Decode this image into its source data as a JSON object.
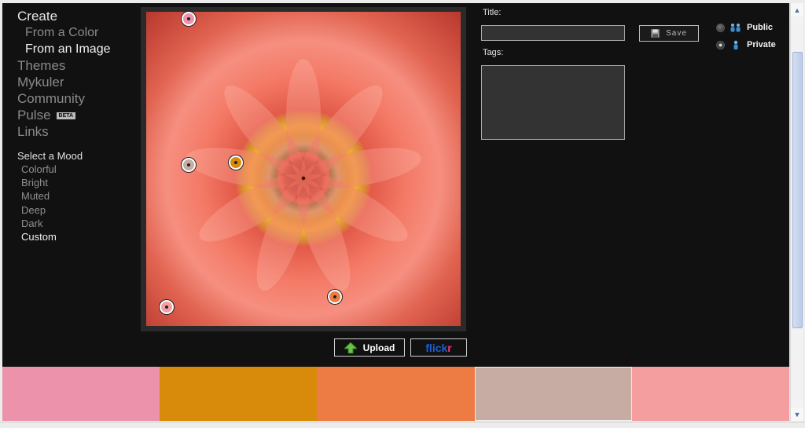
{
  "nav": {
    "items": [
      {
        "label": "Create",
        "active": true
      },
      {
        "label": "From a Color",
        "sub": true
      },
      {
        "label": "From an Image",
        "sub": true,
        "active": true
      },
      {
        "label": "Themes"
      },
      {
        "label": "Mykuler"
      },
      {
        "label": "Community"
      },
      {
        "label": "Pulse",
        "badge": "BETA"
      },
      {
        "label": "Links"
      }
    ]
  },
  "mood": {
    "title": "Select a Mood",
    "options": [
      "Colorful",
      "Bright",
      "Muted",
      "Deep",
      "Dark",
      "Custom"
    ],
    "selected": "Custom"
  },
  "image_panel": {
    "upload_label": "Upload",
    "flickr_label": {
      "part1": "flick",
      "part2": "r"
    }
  },
  "form": {
    "title_label": "Title:",
    "title_value": "",
    "tags_label": "Tags:",
    "tags_value": "",
    "save_label": "Save",
    "visibility": {
      "options": [
        {
          "label": "Public",
          "checked": false
        },
        {
          "label": "Private",
          "checked": true
        }
      ]
    }
  },
  "swatches": [
    {
      "color": "#ec92ab"
    },
    {
      "color": "#d88a0b"
    },
    {
      "color": "#ed7c44"
    },
    {
      "color": "#c6aca3",
      "selected": true
    },
    {
      "color": "#f59ea0"
    }
  ],
  "theme": {
    "background": "#111111",
    "text_active": "#e6e6e6",
    "text_muted": "#8a8a8a",
    "upload_icon": "green-up-arrow-icon",
    "save_icon": "floppy-disk-icon",
    "public_icon": "people-group-icon",
    "private_icon": "single-person-icon"
  }
}
